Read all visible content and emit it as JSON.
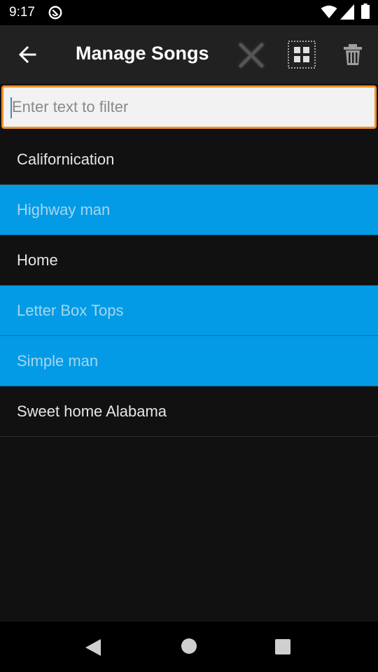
{
  "status_bar": {
    "time": "9:17",
    "icons": [
      "do-not-disturb-icon",
      "wifi-icon",
      "signal-icon",
      "battery-icon"
    ]
  },
  "app_bar": {
    "title": "Manage Songs",
    "icons": [
      "back-arrow-icon",
      "close-icon",
      "select-all-icon",
      "trash-icon"
    ]
  },
  "filter": {
    "placeholder": "Enter text to filter",
    "value": ""
  },
  "songs": [
    {
      "title": "Californication",
      "selected": false
    },
    {
      "title": "Highway man",
      "selected": true
    },
    {
      "title": "Home",
      "selected": false
    },
    {
      "title": "Letter Box Tops",
      "selected": true
    },
    {
      "title": "Simple man",
      "selected": true
    },
    {
      "title": "Sweet home Alabama",
      "selected": false
    }
  ],
  "colors": {
    "accent_selected": "#039be5",
    "filter_border": "#f0902a",
    "app_bar": "#212121",
    "background": "#111111"
  },
  "nav_bar": {
    "icons": [
      "nav-back-icon",
      "nav-home-icon",
      "nav-recent-icon"
    ]
  }
}
